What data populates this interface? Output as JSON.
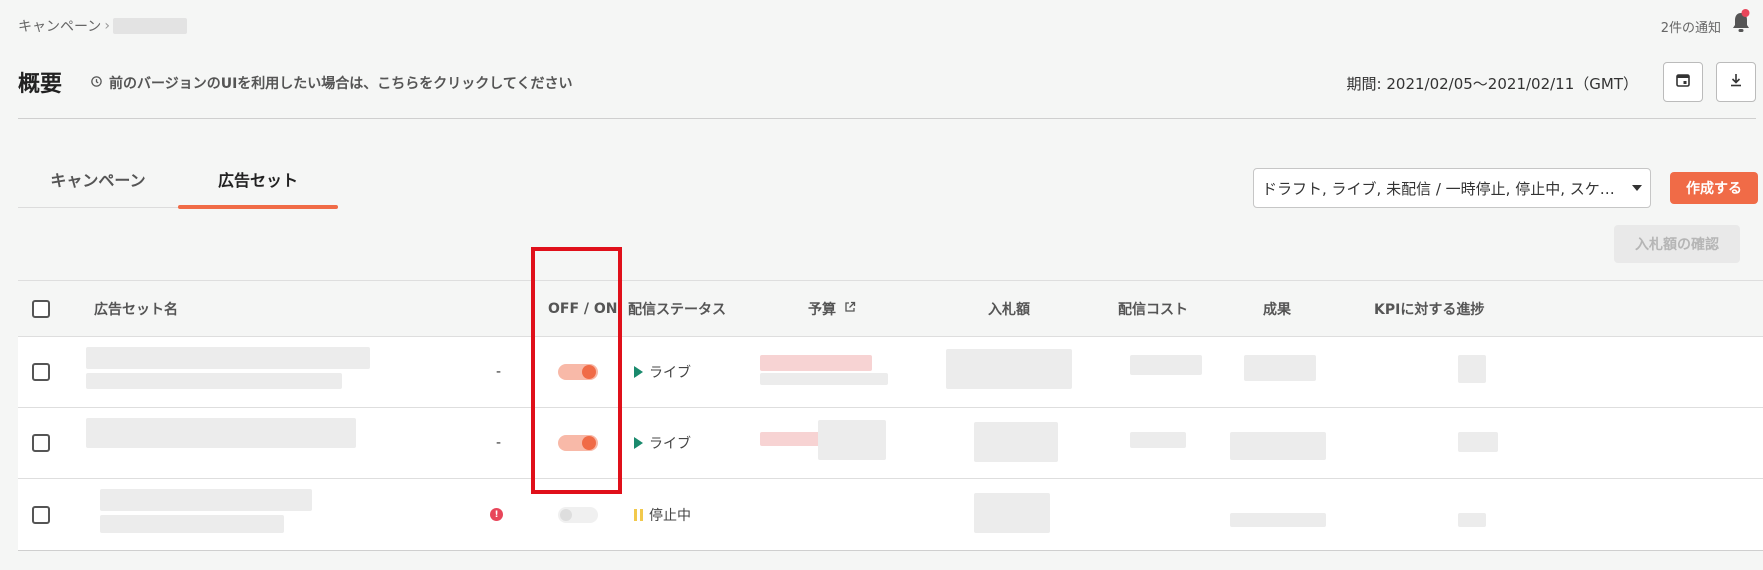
{
  "breadcrumb": {
    "root": "キャンペーン",
    "separator": "›"
  },
  "notifications": {
    "label": "2件の通知"
  },
  "header": {
    "title": "概要",
    "legacy_link": "前のバージョンのUIを利用したい場合は、こちらをクリックしてください",
    "period": "期間: 2021/02/05〜2021/02/11（GMT）"
  },
  "tabs": [
    {
      "label": "キャンペーン",
      "active": false
    },
    {
      "label": "広告セット",
      "active": true
    }
  ],
  "filter": {
    "value": "ドラフト, ライブ, 未配信 / 一時停止, 停止中, スケ…"
  },
  "buttons": {
    "create": "作成する",
    "confirm_bid": "入札額の確認"
  },
  "table": {
    "columns": {
      "name": "広告セット名",
      "toggle": "OFF / ON",
      "status": "配信ステータス",
      "budget": "予算",
      "bid": "入札額",
      "cost": "配信コスト",
      "result": "成果",
      "kpi": "KPIに対する進捗"
    },
    "rows": [
      {
        "flag": "-",
        "on": true,
        "status": "ライブ",
        "status_icon": "play-icon"
      },
      {
        "flag": "-",
        "on": true,
        "status": "ライブ",
        "status_icon": "play-icon"
      },
      {
        "flag": "!",
        "on": false,
        "status": "停止中",
        "status_icon": "pause-icon"
      }
    ]
  },
  "colors": {
    "accent": "#f06b47",
    "live": "#1a8a6d",
    "paused": "#f2c94c",
    "error": "#e8465a",
    "highlight": "#e0101a"
  }
}
